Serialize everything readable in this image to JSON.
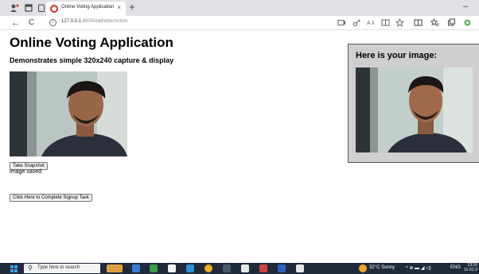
{
  "browser": {
    "tab_title": "Online Voting Application",
    "tab_close": "×",
    "new_tab": "+",
    "minimize": "–",
    "url_host": "127.0.0.1",
    "url_rest": ":8000/AddVoterAction",
    "back": "←",
    "reload": "C"
  },
  "page": {
    "title": "Online Voting Application",
    "subtitle": "Demonstrates simple 320x240 capture & display",
    "snapshot_button": "Take Snapshot",
    "status": "Image saved",
    "signup_button": "Click Here to Complete Signup Task",
    "result_heading": "Here is your image:"
  },
  "taskbar": {
    "search_placeholder": "Type here to search",
    "weather": "32°C  Sunny",
    "language": "ENG",
    "time": "13:16",
    "date": "11-01-2"
  }
}
